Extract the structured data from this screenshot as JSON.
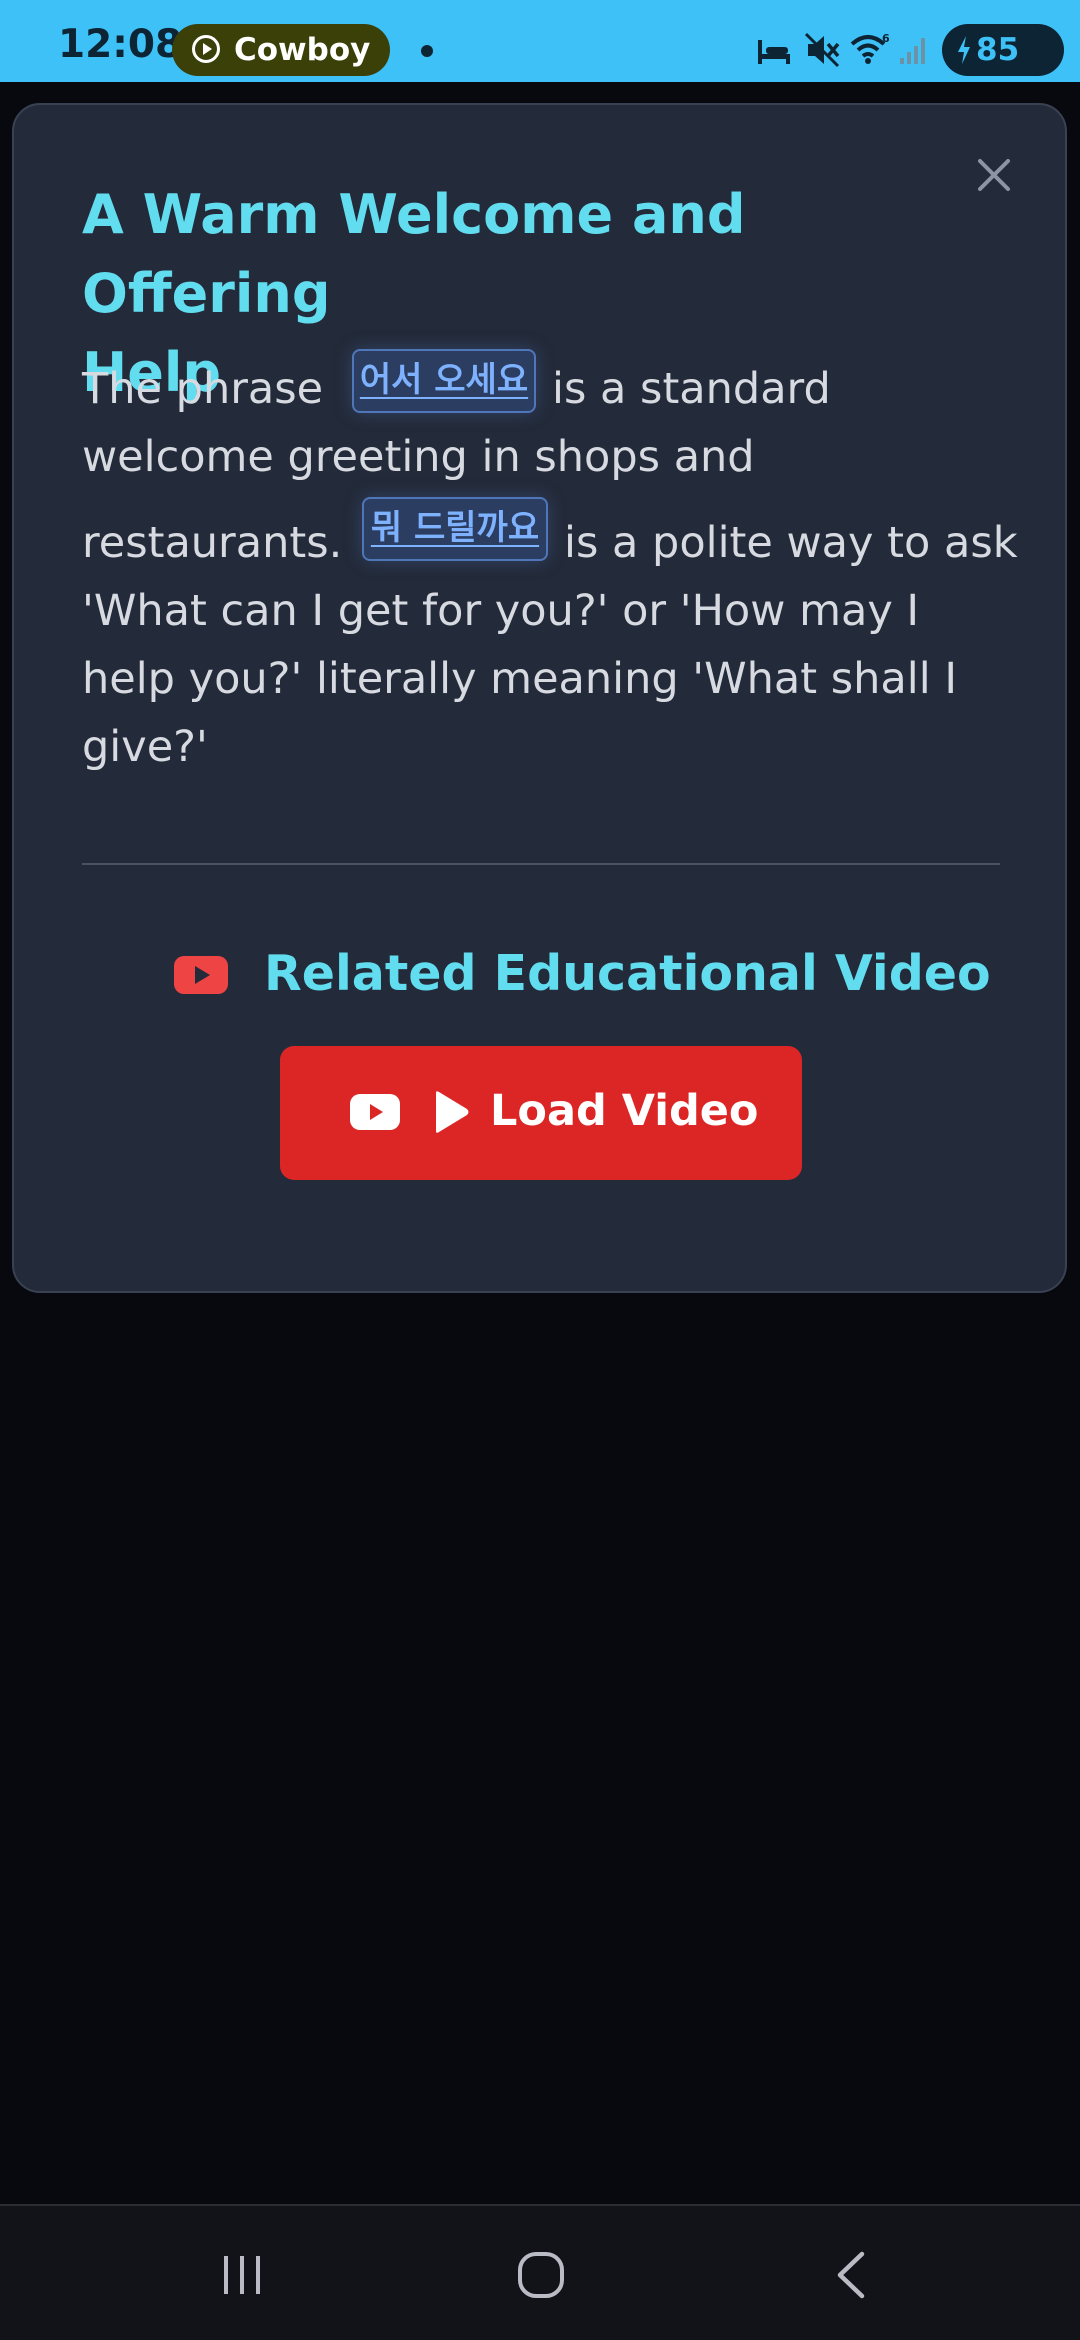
{
  "status_bar": {
    "time": "12:08",
    "media_app_label": "Cowboy",
    "battery_level": "85",
    "icons": [
      "sleep-icon",
      "mute-icon",
      "wifi-icon",
      "signal-icon",
      "battery-charging-icon"
    ],
    "bar_color": "#3ec1f7"
  },
  "dialog": {
    "title": "A Warm Welcome and Offering Help",
    "title_lines": [
      "A Warm Welcome and Offering",
      "Help"
    ],
    "paragraph": {
      "segment_1": "The phrase",
      "korean_1": "어서 오세요",
      "segment_2": "is a standard",
      "segment_3": "welcome greeting in shops and",
      "segment_4": "restaurants.",
      "korean_2": "뭐 드릴까요",
      "segment_5": "is a polite way to ask",
      "segment_6": "'What can I get for you?' or 'How may I",
      "segment_7": "help you?' literally meaning 'What shall I",
      "segment_8": "give?'"
    },
    "close_icon": "close-icon",
    "video_section": {
      "title": "Related Educational Video",
      "load_button_label": "Load Video",
      "button_color": "#dc2626"
    },
    "accent_color": "#62dcef"
  },
  "nav_bar": {
    "buttons": [
      "recent-apps-icon",
      "home-icon",
      "back-icon"
    ]
  }
}
